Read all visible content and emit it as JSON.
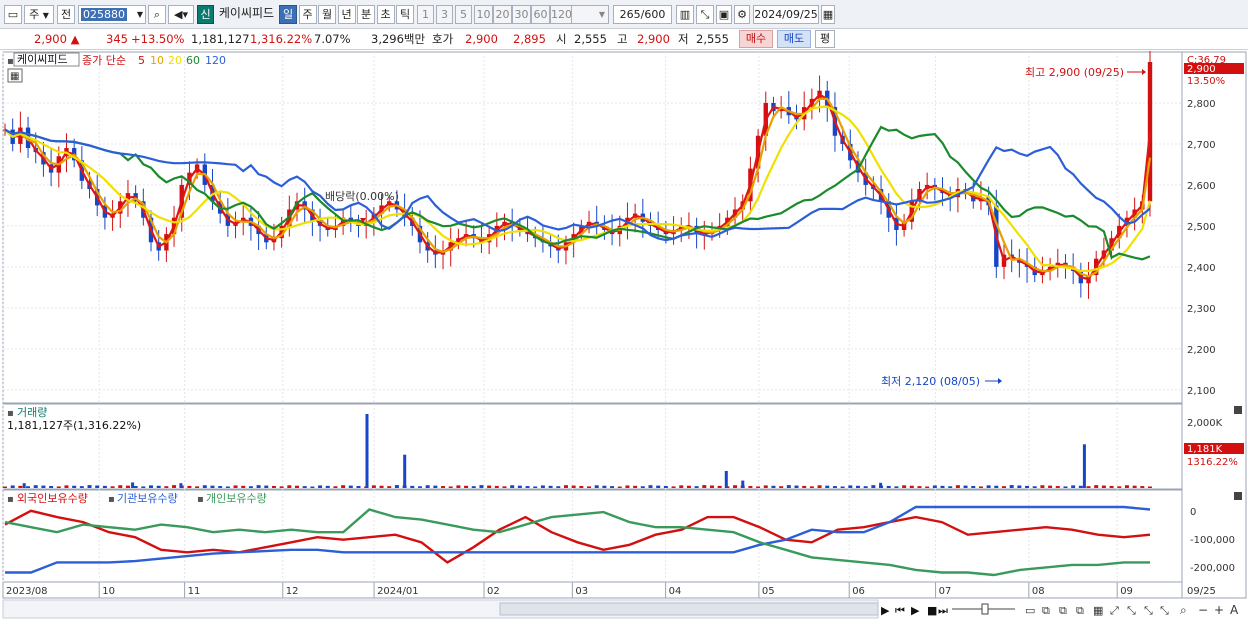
{
  "toolbar": {
    "market": "주",
    "prefix": "전",
    "code": "025880",
    "badge_new": "신",
    "stock_name": "케이씨피드",
    "periods": [
      "일",
      "주",
      "월",
      "년",
      "분",
      "초",
      "틱"
    ],
    "active_period": "일",
    "intervals": [
      "1",
      "3",
      "5",
      "10",
      "20",
      "30",
      "60",
      "120"
    ],
    "count": "265",
    "count_max": "/600",
    "date": "2024/09/25"
  },
  "quote": {
    "price": "2,900",
    "change": "345",
    "change_pct": "+13.50%",
    "volume": "1,181,127",
    "volume_ratio": "1,316.22%",
    "turnover": "7.07%",
    "amount": "3,296백만",
    "bid_label": "호가",
    "ask": "2,900",
    "bid": "2,895",
    "open_label": "시",
    "open": "2,555",
    "high_label": "고",
    "high": "2,900",
    "low_label": "저",
    "low": "2,555",
    "buy_label": "매수",
    "sell_label": "매도",
    "eval_label": "평"
  },
  "legend": {
    "name": "케이씨피드",
    "ma_label": "종가 단순",
    "ma_periods": [
      "5",
      "10",
      "20",
      "60",
      "120"
    ],
    "ma_colors": [
      "#e01515",
      "#e8a000",
      "#f0e000",
      "#1b8a2c",
      "#2c5fd6"
    ]
  },
  "annotations": {
    "max": "최고 2,900 (09/25)",
    "min": "최저 2,120 (08/05)",
    "dividend": "배당락(0.00%)"
  },
  "price_axis": {
    "current_label": "2,900",
    "current_pct": "13.50%",
    "top_label": "C:36.79"
  },
  "volume_panel": {
    "title": "거래량",
    "value": "1,181,127주(1,316.22%)",
    "current_label": "1,181K",
    "current_pct": "1316.22%"
  },
  "holding_panel": {
    "series_names": [
      "외국인보유수량",
      "기관보유수량",
      "개인보유수량"
    ],
    "series_colors": [
      "#d21010",
      "#2c5fd6",
      "#3a9a5c"
    ]
  },
  "x_axis_last": "09/25",
  "chart_data": [
    {
      "type": "line",
      "title": "케이씨피드",
      "ylim": [
        2080,
        2900
      ],
      "yticks": [
        2100,
        2200,
        2300,
        2400,
        2500,
        2600,
        2700,
        2800
      ],
      "x_labels": [
        "2023/08",
        "10",
        "11",
        "12",
        "2024/01",
        "02",
        "03",
        "04",
        "05",
        "06",
        "07",
        "08",
        "09"
      ],
      "x_label_pos": [
        0,
        0.098,
        0.185,
        0.285,
        0.378,
        0.49,
        0.58,
        0.675,
        0.77,
        0.862,
        0.95,
        1.045,
        1.135
      ],
      "closes": [
        2735,
        2700,
        2740,
        2690,
        2680,
        2650,
        2630,
        2670,
        2690,
        2660,
        2610,
        2590,
        2550,
        2520,
        2530,
        2560,
        2580,
        2560,
        2520,
        2460,
        2440,
        2480,
        2520,
        2600,
        2630,
        2650,
        2600,
        2560,
        2530,
        2500,
        2510,
        2520,
        2500,
        2480,
        2460,
        2470,
        2500,
        2540,
        2560,
        2540,
        2510,
        2500,
        2490,
        2500,
        2520,
        2510,
        2500,
        2510,
        2530,
        2550,
        2560,
        2540,
        2520,
        2500,
        2460,
        2440,
        2430,
        2440,
        2460,
        2470,
        2480,
        2470,
        2460,
        2480,
        2500,
        2510,
        2500,
        2490,
        2480,
        2470,
        2460,
        2450,
        2440,
        2460,
        2480,
        2500,
        2510,
        2500,
        2490,
        2480,
        2500,
        2520,
        2530,
        2510,
        2500,
        2490,
        2480,
        2490,
        2500,
        2500,
        2480,
        2480,
        2490,
        2500,
        2520,
        2540,
        2560,
        2640,
        2720,
        2800,
        2780,
        2790,
        2770,
        2760,
        2790,
        2810,
        2830,
        2790,
        2720,
        2700,
        2660,
        2630,
        2600,
        2590,
        2560,
        2520,
        2490,
        2510,
        2560,
        2590,
        2600,
        2590,
        2580,
        2570,
        2590,
        2580,
        2560,
        2570,
        2550,
        2400,
        2430,
        2420,
        2410,
        2400,
        2380,
        2390,
        2400,
        2410,
        2400,
        2390,
        2360,
        2380,
        2420,
        2440,
        2470,
        2500,
        2520,
        2540,
        2560,
        2900
      ],
      "series": [
        {
          "name": "5"
        },
        {
          "name": "10"
        },
        {
          "name": "20"
        },
        {
          "name": "60"
        },
        {
          "name": "120"
        }
      ]
    },
    {
      "type": "bar",
      "title": "거래량",
      "yticks": [
        "2,000K"
      ],
      "spikes": [
        {
          "x": 0.018,
          "v": 130
        },
        {
          "x": 0.11,
          "v": 150
        },
        {
          "x": 0.151,
          "v": 130
        },
        {
          "x": 0.309,
          "v": 2000
        },
        {
          "x": 0.341,
          "v": 900
        },
        {
          "x": 0.614,
          "v": 460
        },
        {
          "x": 0.628,
          "v": 200
        },
        {
          "x": 0.745,
          "v": 140
        },
        {
          "x": 0.918,
          "v": 1181
        }
      ]
    },
    {
      "type": "line",
      "title": "보유수량",
      "yticks": [
        "0",
        "-100,000",
        "-200,000"
      ],
      "ylim": [
        -270000,
        40000
      ],
      "series": [
        {
          "name": "외국인보유수량",
          "values": [
            -50000,
            5000,
            -20000,
            -40000,
            -80000,
            -100000,
            -150000,
            -160000,
            -150000,
            -160000,
            -140000,
            -120000,
            -100000,
            -110000,
            -100000,
            -90000,
            -120000,
            -200000,
            -140000,
            -70000,
            -20000,
            -80000,
            -120000,
            -150000,
            -130000,
            -90000,
            -70000,
            -20000,
            -20000,
            -60000,
            -110000,
            -120000,
            -70000,
            -60000,
            -40000,
            -20000,
            -40000,
            -90000,
            -80000,
            -70000,
            -60000,
            -70000,
            -90000,
            -100000,
            -90000
          ]
        },
        {
          "name": "기관보유수량",
          "values": [
            -240000,
            -240000,
            -200000,
            -200000,
            -200000,
            -195000,
            -185000,
            -175000,
            -165000,
            -160000,
            -155000,
            -150000,
            -150000,
            -160000,
            -160000,
            -160000,
            -160000,
            -160000,
            -160000,
            -160000,
            -160000,
            -160000,
            -160000,
            -160000,
            -160000,
            -160000,
            -160000,
            -160000,
            -160000,
            -130000,
            -110000,
            -70000,
            -80000,
            -80000,
            -40000,
            20000,
            20000,
            20000,
            20000,
            20000,
            20000,
            20000,
            20000,
            20000,
            10000
          ]
        },
        {
          "name": "개인보유수량",
          "values": [
            -40000,
            -60000,
            -80000,
            -50000,
            -60000,
            -70000,
            -50000,
            -60000,
            -80000,
            -70000,
            -80000,
            -70000,
            -80000,
            -80000,
            10000,
            -20000,
            -30000,
            -50000,
            -70000,
            -80000,
            -50000,
            -20000,
            -10000,
            0,
            -40000,
            -60000,
            -60000,
            -70000,
            -80000,
            -120000,
            -150000,
            -180000,
            -190000,
            -200000,
            -210000,
            -230000,
            -240000,
            -240000,
            -250000,
            -230000,
            -220000,
            -210000,
            -210000,
            -200000,
            -200000
          ]
        }
      ]
    }
  ]
}
